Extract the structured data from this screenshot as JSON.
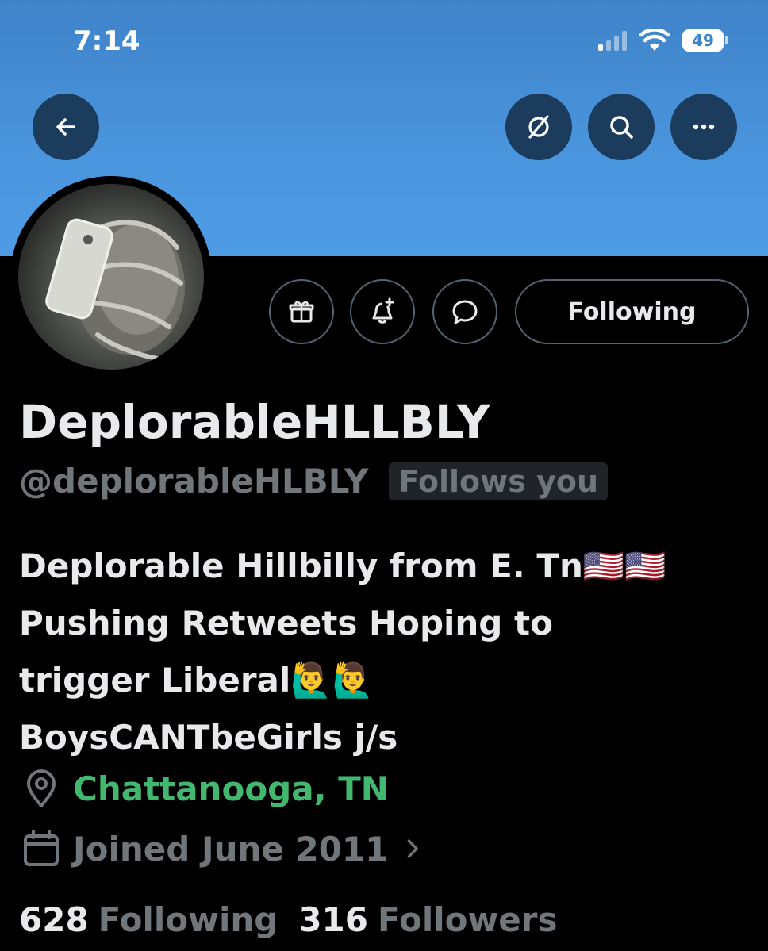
{
  "status_bar": {
    "time": "7:14",
    "battery": "49"
  },
  "profile": {
    "display_name": "DeplorableHLLBLY",
    "handle": "@deplorableHLBLY",
    "follows_you_badge": "Follows you",
    "bio_lines": [
      "Deplorable Hillbilly from E. Tn🇺🇸🇺🇸",
      "Pushing Retweets Hoping to",
      "trigger Liberal🙋‍♂️🙋‍♂️",
      "BoysCANTbeGirls j/s"
    ],
    "location": "Chattanooga, TN",
    "joined": "Joined June 2011",
    "following_count": "628",
    "following_label": "Following",
    "followers_count": "316",
    "followers_label": "Followers"
  },
  "actions": {
    "following_button": "Following"
  },
  "icons": {
    "back": "arrow-left-icon",
    "grok": "grok-icon",
    "search": "search-icon",
    "more": "more-icon",
    "gift": "gift-icon",
    "notify": "bell-plus-icon",
    "message": "message-icon",
    "location": "location-pin-icon",
    "calendar": "calendar-icon",
    "chevron": "chevron-right-icon"
  },
  "colors": {
    "banner": "#4a95dd",
    "button_bg": "#1c3c5e",
    "border": "#536471",
    "secondary_text": "#71767b",
    "location_link": "#42b86f"
  }
}
